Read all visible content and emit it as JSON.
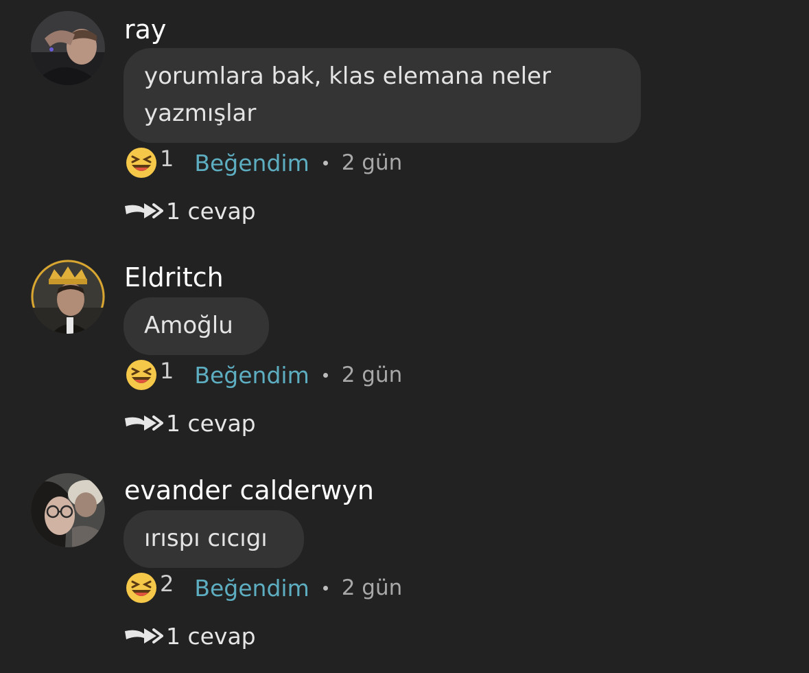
{
  "comments": [
    {
      "username": "ray",
      "text": "yorumlara bak, klas elemana neler yazmışlar",
      "reaction_icon": "laughing-emoji",
      "reaction_count": "1",
      "like_label": "Beğendim",
      "time": "2 gün",
      "replies_label": "1 cevap"
    },
    {
      "username": "Eldritch",
      "text": "Amoğlu",
      "reaction_icon": "laughing-emoji",
      "reaction_count": "1",
      "like_label": "Beğendim",
      "time": "2 gün",
      "replies_label": "1 cevap"
    },
    {
      "username": "evander calderwyn",
      "text": "ırıspı cıcıgı",
      "reaction_icon": "laughing-emoji",
      "reaction_count": "2",
      "like_label": "Beğendim",
      "time": "2 gün",
      "replies_label": "1 cevap"
    }
  ],
  "colors": {
    "background": "#222222",
    "bubble": "#343434",
    "like_link": "#5eaec2",
    "emoji": "#f6c84a"
  },
  "icons": {
    "reply": "reply-arrow-icon",
    "avatar": "user-avatar"
  }
}
